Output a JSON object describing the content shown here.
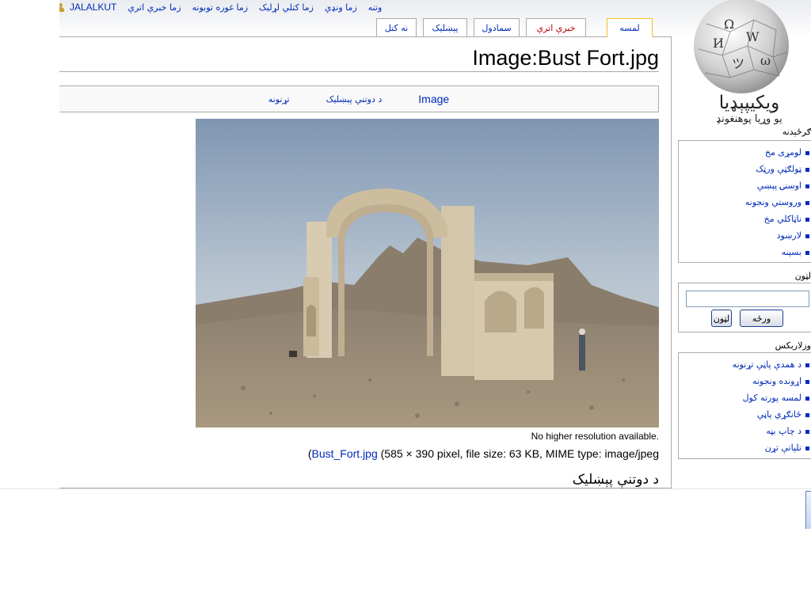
{
  "personal": {
    "user": "JALALKUT",
    "links": [
      "زما خبرې اترې",
      "زما غوره توبونه",
      "زما کتلي لړليک",
      "زما ونډې",
      "وتنه"
    ]
  },
  "tabs": {
    "article": "لمسه",
    "discussion": "خبرې اترې",
    "edit": "سمادول",
    "history": "پېښليک",
    "watch": "نه کتل"
  },
  "page_title": "Image:Bust Fort.jpg",
  "filetoc": {
    "image": "Image",
    "history": "د دوتنې پېښليک",
    "links": "تړنونه"
  },
  "file": {
    "no_higher": "No higher resolution available.",
    "name": "Bust_Fort.jpg",
    "info_prefix": "(",
    "info_rest": " (585 × 390 pixel, file size: 63 KB, MIME type: image/jpeg"
  },
  "section_heading": "د دوتنې پېښليک",
  "logo": {
    "name": "ويکيپېډيا",
    "tagline": "يو وړيا پوهنغونډ"
  },
  "navigation": {
    "title": "ګرځېدنه",
    "items": [
      "لومړی مخ",
      "ټولګټې ورټک",
      "اوسنۍ پېښې",
      "وروستي ونجونه",
      "ناټاکلي مخ",
      "لارښود",
      "بسپنه"
    ]
  },
  "search": {
    "title": "لټون",
    "go": "ورځه",
    "search": "لټون"
  },
  "toolbox": {
    "title": "وزلاربکس",
    "items": [
      "د همدې پاڼې تړنونه",
      "اړونده ونجونه",
      "لمسه پورته کول",
      "ځانګړي پاڼې",
      "د چاپ بڼه",
      "تلپاتې تړن"
    ]
  },
  "colors": {
    "link": "#002bb8",
    "newlink": "#ba0000",
    "selected_tab": "#fabd23"
  }
}
